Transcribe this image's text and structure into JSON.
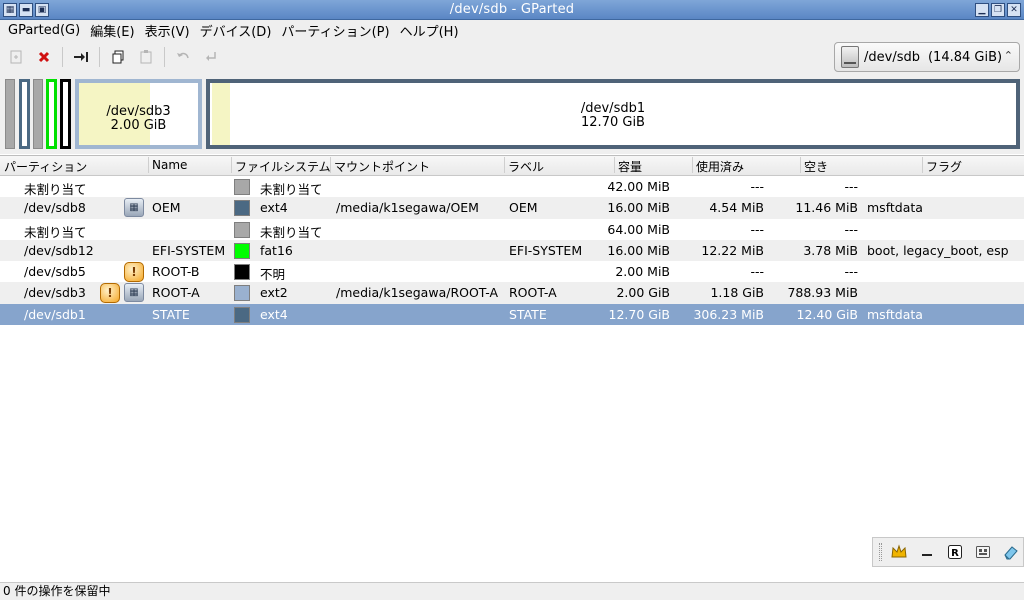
{
  "window": {
    "title": "/dev/sdb - GParted"
  },
  "menu": [
    {
      "label": "GParted(G)"
    },
    {
      "label": "編集(E)"
    },
    {
      "label": "表示(V)"
    },
    {
      "label": "デバイス(D)"
    },
    {
      "label": "パーティション(P)"
    },
    {
      "label": "ヘルプ(H)"
    }
  ],
  "toolbar": {
    "icons": [
      "new-partition-icon",
      "delete-icon",
      "resize-move-icon",
      "copy-icon",
      "paste-icon",
      "undo-icon",
      "apply-icon"
    ]
  },
  "device_selector": {
    "device": "/dev/sdb",
    "size": "(14.84 GiB)"
  },
  "map": {
    "sdb3": {
      "name": "/dev/sdb3",
      "size": "2.00 GiB",
      "used_fraction": 0.6
    },
    "sdb1": {
      "name": "/dev/sdb1",
      "size": "12.70 GiB",
      "used_fraction": 0.025
    }
  },
  "columns": [
    "パーティション",
    "Name",
    "ファイルシステム",
    "マウントポイント",
    "ラベル",
    "容量",
    "使用済み",
    "空き",
    "フラグ"
  ],
  "rows": [
    {
      "partition": "未割り当て",
      "name": "",
      "fs": "未割り当て",
      "fs_color": "#a8a8a8",
      "mount": "",
      "label": "",
      "size": "42.00 MiB",
      "used": "---",
      "free": "---",
      "flags": "",
      "icons": []
    },
    {
      "partition": "/dev/sdb8",
      "name": "OEM",
      "fs": "ext4",
      "fs_color": "#4b6983",
      "mount": "/media/k1segawa/OEM",
      "label": "OEM",
      "size": "16.00 MiB",
      "used": "4.54 MiB",
      "free": "11.46 MiB",
      "flags": "msftdata",
      "icons": [
        "info"
      ]
    },
    {
      "partition": "未割り当て",
      "name": "",
      "fs": "未割り当て",
      "fs_color": "#a8a8a8",
      "mount": "",
      "label": "",
      "size": "64.00 MiB",
      "used": "---",
      "free": "---",
      "flags": "",
      "icons": []
    },
    {
      "partition": "/dev/sdb12",
      "name": "EFI-SYSTEM",
      "fs": "fat16",
      "fs_color": "#00ff00",
      "mount": "",
      "label": "EFI-SYSTEM",
      "size": "16.00 MiB",
      "used": "12.22 MiB",
      "free": "3.78 MiB",
      "flags": "boot, legacy_boot, esp",
      "icons": []
    },
    {
      "partition": "/dev/sdb5",
      "name": "ROOT-B",
      "fs": "不明",
      "fs_color": "#000000",
      "mount": "",
      "label": "",
      "size": "2.00 MiB",
      "used": "---",
      "free": "---",
      "flags": "",
      "icons": [
        "warn"
      ]
    },
    {
      "partition": "/dev/sdb3",
      "name": "ROOT-A",
      "fs": "ext2",
      "fs_color": "#9ab1cf",
      "mount": "/media/k1segawa/ROOT-A",
      "label": "ROOT-A",
      "size": "2.00 GiB",
      "used": "1.18 GiB",
      "free": "788.93 MiB",
      "flags": "",
      "icons": [
        "warn",
        "info"
      ]
    },
    {
      "partition": "/dev/sdb1",
      "name": "STATE",
      "fs": "ext4",
      "fs_color": "#4b6983",
      "mount": "",
      "label": "STATE",
      "size": "12.70 GiB",
      "used": "306.23 MiB",
      "free": "12.40 GiB",
      "flags": "msftdata",
      "icons": []
    }
  ],
  "mini_toolbar": {
    "icons": [
      "crown-icon",
      "minimize-icon",
      "r-icon",
      "keyboard-icon",
      "eraser-icon"
    ]
  },
  "status": "0 件の操作を保留中"
}
